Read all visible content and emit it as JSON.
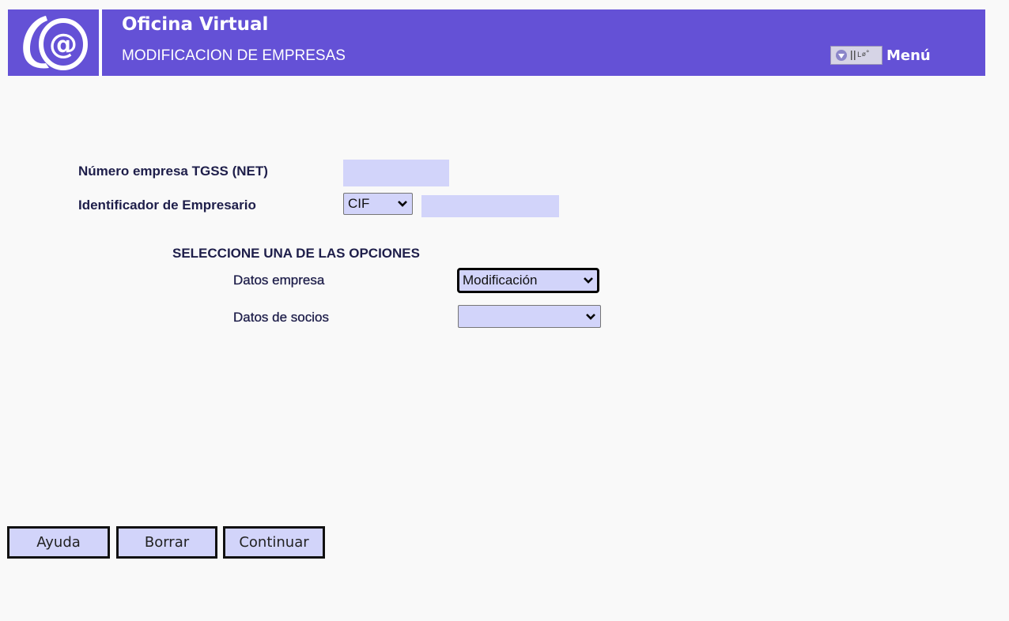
{
  "header": {
    "app_title": "Oficina Virtual",
    "page_subtitle": "MODIFICACION DE EMPRESAS",
    "menu_label": "Menú",
    "logo_icon": "at-sign-logo-icon",
    "colors": {
      "header_bg": "#6451d6",
      "field_bg": "#d2d4fa",
      "label_text": "#1e1e4a"
    }
  },
  "form": {
    "net_label": "Número empresa TGSS (NET)",
    "net_value": "",
    "employer_id_label": "Identificador de Empresario",
    "employer_id_type": "CIF",
    "employer_id_value": "",
    "options_heading": "SELECCIONE UNA DE LAS OPCIONES",
    "company_data_label": "Datos empresa",
    "company_data_value": "Modificación",
    "partners_data_label": "Datos de socios",
    "partners_data_value": ""
  },
  "buttons": {
    "help": "Ayuda",
    "clear": "Borrar",
    "continue": "Continuar"
  }
}
